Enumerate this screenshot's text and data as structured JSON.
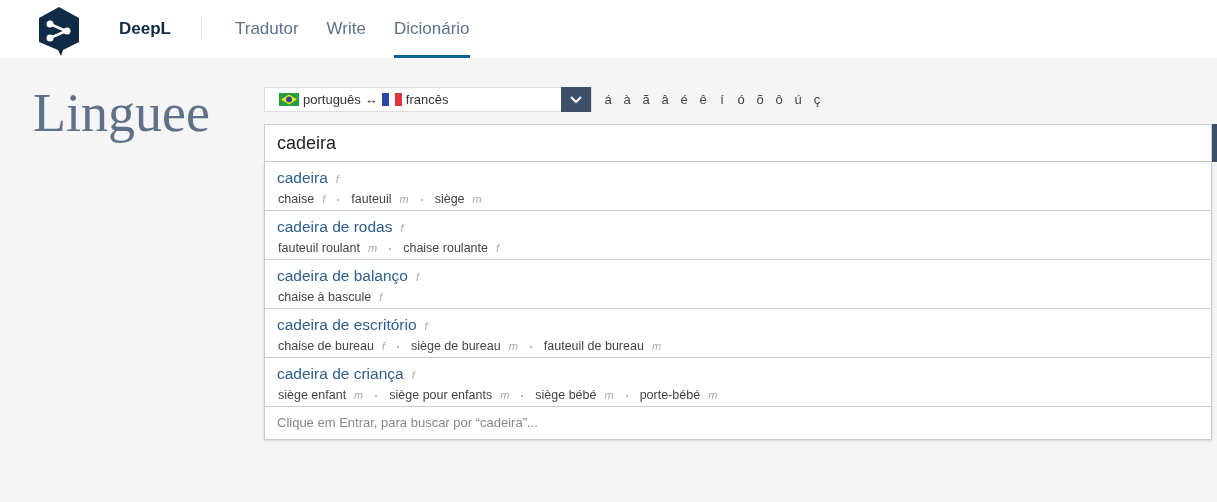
{
  "header": {
    "brand": "DeepL",
    "tabs": [
      {
        "label": "Tradutor",
        "selected": false
      },
      {
        "label": "Write",
        "selected": false
      },
      {
        "label": "Dicionário",
        "selected": true
      }
    ]
  },
  "logo": {
    "text": "Linguee"
  },
  "language_select": {
    "source": "português",
    "arrow": "↔",
    "target": "francês"
  },
  "special_characters": [
    "á",
    "à",
    "ã",
    "â",
    "é",
    "ê",
    "í",
    "ó",
    "õ",
    "ô",
    "ú",
    "ç"
  ],
  "search": {
    "value": "cadeira"
  },
  "suggestions": [
    {
      "term": "cadeira",
      "gender": "f",
      "translations": [
        {
          "text": "chaise",
          "gender": "f"
        },
        {
          "text": "fauteuil",
          "gender": "m"
        },
        {
          "text": "siège",
          "gender": "m"
        }
      ]
    },
    {
      "term": "cadeira de rodas",
      "gender": "f",
      "translations": [
        {
          "text": "fauteuil roulant",
          "gender": "m"
        },
        {
          "text": "chaise roulante",
          "gender": "f"
        }
      ]
    },
    {
      "term": "cadeira de balanço",
      "gender": "f",
      "translations": [
        {
          "text": "chaise à bascule",
          "gender": "f"
        }
      ]
    },
    {
      "term": "cadeira de escritório",
      "gender": "f",
      "translations": [
        {
          "text": "chaise de bureau",
          "gender": "f"
        },
        {
          "text": "siège de bureau",
          "gender": "m"
        },
        {
          "text": "fauteuil de bureau",
          "gender": "m"
        }
      ]
    },
    {
      "term": "cadeira de criança",
      "gender": "f",
      "translations": [
        {
          "text": "siège enfant",
          "gender": "m"
        },
        {
          "text": "siège pour enfants",
          "gender": "m"
        },
        {
          "text": "siège bébé",
          "gender": "m"
        },
        {
          "text": "porte-bébé",
          "gender": "m"
        }
      ]
    }
  ],
  "footer_hint": "Clique em Entrar, para buscar por “cadeira”..."
}
